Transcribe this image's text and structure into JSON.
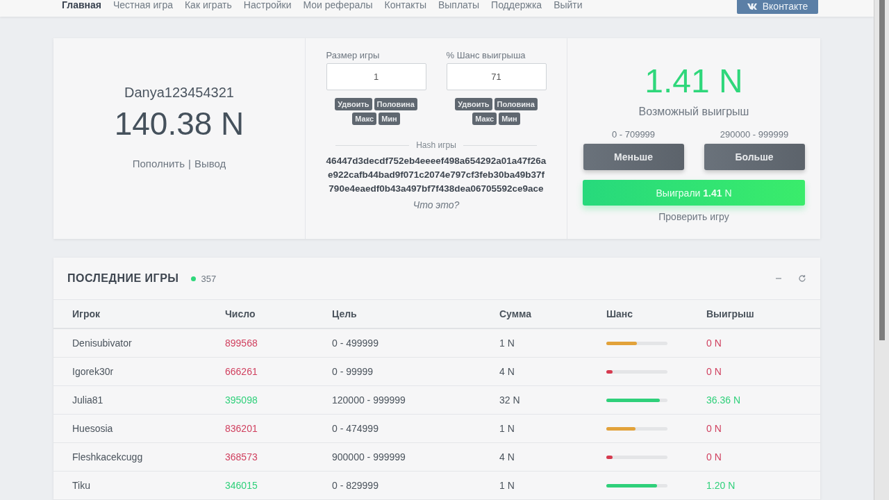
{
  "nav": {
    "items": [
      {
        "label": "Главная",
        "selected": true
      },
      {
        "label": "Честная игра",
        "selected": false
      },
      {
        "label": "Как играть",
        "selected": false
      },
      {
        "label": "Настройки",
        "selected": false
      },
      {
        "label": "Мои рефералы",
        "selected": false
      },
      {
        "label": "Контакты",
        "selected": false
      },
      {
        "label": "Выплаты",
        "selected": false
      },
      {
        "label": "Поддержка",
        "selected": false
      },
      {
        "label": "Выйти",
        "selected": false
      }
    ],
    "social_button": "Вконтакте"
  },
  "balance": {
    "username": "Danya123454321",
    "amount": "140.38 N",
    "links": [
      "Пополнить",
      "Вывод"
    ],
    "separator": "|"
  },
  "bet": {
    "fields": [
      {
        "label": "Размер игры",
        "value": "1",
        "buttons": [
          "Удвоить",
          "Половина",
          "Макс",
          "Мин"
        ]
      },
      {
        "label": "% Шанс выигрыша",
        "value": "71",
        "buttons": [
          "Удвоить",
          "Половина",
          "Макс",
          "Мин"
        ]
      }
    ],
    "hash_label": "Hash игры",
    "hash": "46447d3decdf752eb4eeeef498a654292a01a47f26ae922cafb44bad9f071c2074e797cf3feb30ba49b37f790e4eaedf0b43a497bf7f438dea06705592ce9ace",
    "help_link": "Что это?"
  },
  "result": {
    "payout": "1.41 N",
    "payout_label": "Возможный выигрыш",
    "options": [
      {
        "range": "0 - 709999",
        "button": "Меньше"
      },
      {
        "range": "290000 - 999999",
        "button": "Больше"
      }
    ],
    "win_banner": "Выиграли **1.41** N",
    "verify_link": "Проверить игру"
  },
  "games": {
    "title": "ПОСЛЕДНИЕ ИГРЫ",
    "online_count": "357",
    "columns": [
      "Игрок",
      "Число",
      "Цель",
      "Сумма",
      "Шанс",
      "Выигрыш"
    ],
    "rows": [
      {
        "player": "Denisubivator",
        "number": "899568",
        "target": "0 - 499999",
        "amount": "1 N",
        "level": 0.5,
        "won": false,
        "win": "0 N"
      },
      {
        "player": "Igorek30r",
        "number": "666261",
        "target": "0 - 99999",
        "amount": "4 N",
        "level": 0.1,
        "won": false,
        "win": "0 N"
      },
      {
        "player": "Julia81",
        "number": "395098",
        "target": "120000 - 999999",
        "amount": "32 N",
        "level": 0.88,
        "won": true,
        "win": "36.36 N"
      },
      {
        "player": "Huesosia",
        "number": "836201",
        "target": "0 - 474999",
        "amount": "1 N",
        "level": 0.475,
        "won": false,
        "win": "0 N"
      },
      {
        "player": "Fleshkacekcugg",
        "number": "368573",
        "target": "900000 - 999999",
        "amount": "4 N",
        "level": 0.1,
        "won": false,
        "win": "0 N"
      },
      {
        "player": "Tiku",
        "number": "346015",
        "target": "0 - 829999",
        "amount": "1 N",
        "level": 0.83,
        "won": true,
        "win": "1.20 N"
      }
    ]
  }
}
